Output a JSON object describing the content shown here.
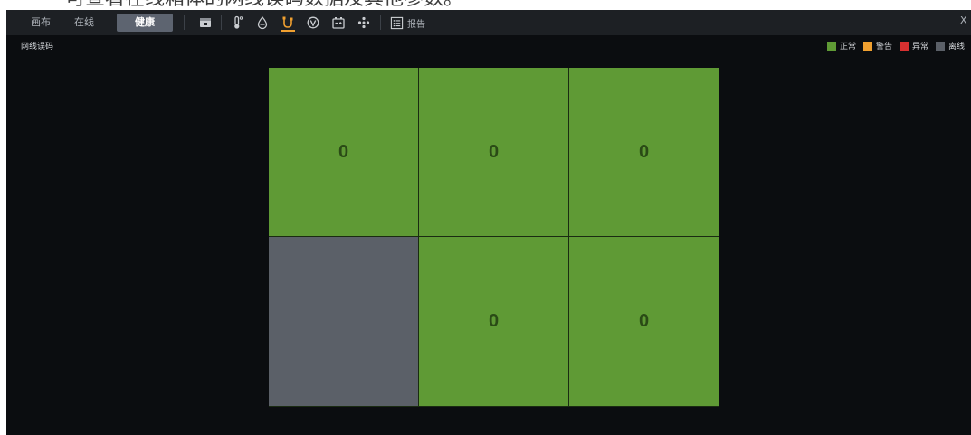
{
  "doc_caption": "可查看在线箱体的网线误码数据及其他参数。",
  "toolbar": {
    "tabs": [
      {
        "label": "画布",
        "active": false
      },
      {
        "label": "在线",
        "active": false
      },
      {
        "label": "健康",
        "active": true
      }
    ],
    "icons": [
      {
        "name": "monitor-icon",
        "active": false
      },
      {
        "name": "thermometer-icon",
        "active": false
      },
      {
        "name": "humidity-icon",
        "active": false
      },
      {
        "name": "network-cable-icon",
        "active": true
      },
      {
        "name": "voltage-icon",
        "active": false
      },
      {
        "name": "battery-icon",
        "active": false
      },
      {
        "name": "fan-icon",
        "active": false
      }
    ],
    "report_label": "报告",
    "close_label": "X"
  },
  "section_title": "网线误码",
  "legend": [
    {
      "label": "正常",
      "color": "#5f9a35"
    },
    {
      "label": "警告",
      "color": "#f0a030"
    },
    {
      "label": "异常",
      "color": "#d83030"
    },
    {
      "label": "离线",
      "color": "#5b6068"
    }
  ],
  "cells": [
    {
      "value": "0",
      "status": "normal"
    },
    {
      "value": "0",
      "status": "normal"
    },
    {
      "value": "0",
      "status": "normal"
    },
    {
      "value": "",
      "status": "offline"
    },
    {
      "value": "0",
      "status": "normal"
    },
    {
      "value": "0",
      "status": "normal"
    }
  ],
  "status_colors": {
    "normal": "#5f9a35",
    "warning": "#f0a030",
    "error": "#d83030",
    "offline": "#5b6068"
  },
  "accent_color": "#f0a030"
}
